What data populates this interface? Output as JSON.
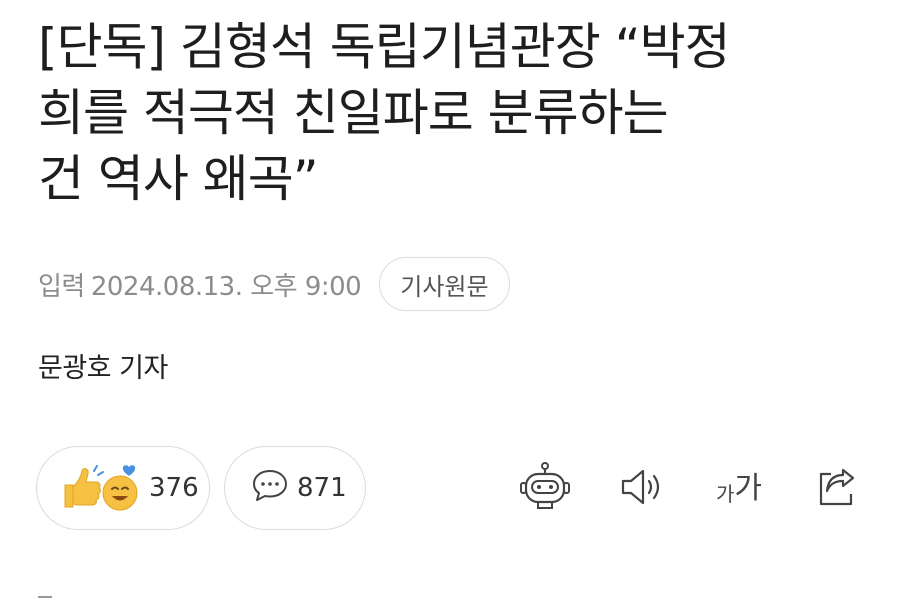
{
  "article": {
    "headline_lines": [
      "[단독] 김형석 독립기념관장 “박정",
      "희를 적극적 친일파로 분류하는",
      "건 역사 왜곡”"
    ],
    "published_label": "입력",
    "published_date": "2024.08.13. 오후 9:00",
    "origin_button": "기사원문",
    "reporter": "문광호 기자"
  },
  "actions": {
    "reaction_count": "376",
    "comment_count": "871",
    "font_size_small": "가",
    "font_size_big": "가"
  },
  "icons": {
    "reaction": "thumbs-up-and-smile-emoji",
    "comment": "speech-bubble-icon",
    "summary": "robot-icon",
    "tts": "speaker-icon",
    "font": "font-size-icon",
    "share": "share-icon"
  },
  "colors": {
    "text": "#1e1e1e",
    "meta": "#8c8c8c",
    "border": "#dcdcdc",
    "emoji_yellow": "#f6c142",
    "emoji_blue": "#4a90e2"
  }
}
